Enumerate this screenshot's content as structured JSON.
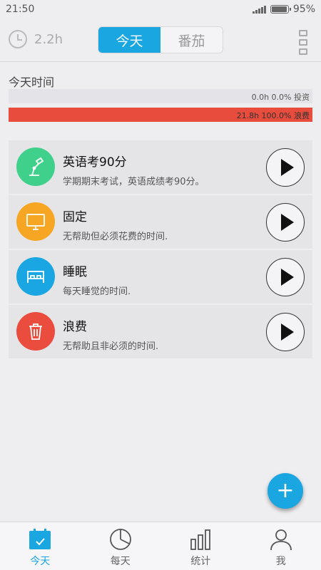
{
  "status_bar": {
    "time": "21:50",
    "battery": "95%"
  },
  "header": {
    "clock_hours": "2.2h",
    "tabs": [
      {
        "label": "今天",
        "active": true
      },
      {
        "label": "番茄",
        "active": false
      }
    ]
  },
  "today": {
    "title": "今天时间",
    "invest_label": "0.0h 0.0% 投资",
    "invest_fraction": 0.0,
    "waste_label": "21.8h 100.0% 浪费",
    "waste_fraction": 1.0
  },
  "tasks": [
    {
      "title": "英语考90分",
      "desc": "学期期末考试，英语成绩考90分。",
      "color": "#3fd18b",
      "icon": "lamp-icon"
    },
    {
      "title": "固定",
      "desc": "无帮助但必须花费的时间.",
      "color": "#f6a623",
      "icon": "monitor-icon"
    },
    {
      "title": "睡眠",
      "desc": "每天睡觉的时间.",
      "color": "#19a6e2",
      "icon": "bed-icon"
    },
    {
      "title": "浪费",
      "desc": "无帮助且非必须的时间.",
      "color": "#ea4c3e",
      "icon": "trash-icon"
    }
  ],
  "fab": {
    "label": "+"
  },
  "bottom_nav": [
    {
      "label": "今天",
      "icon": "calendar-check-icon",
      "active": true
    },
    {
      "label": "每天",
      "icon": "pie-chart-icon",
      "active": false
    },
    {
      "label": "统计",
      "icon": "bar-chart-icon",
      "active": false
    },
    {
      "label": "我",
      "icon": "person-icon",
      "active": false
    }
  ],
  "colors": {
    "accent": "#1aa6e0",
    "waste": "#e74c3c"
  }
}
